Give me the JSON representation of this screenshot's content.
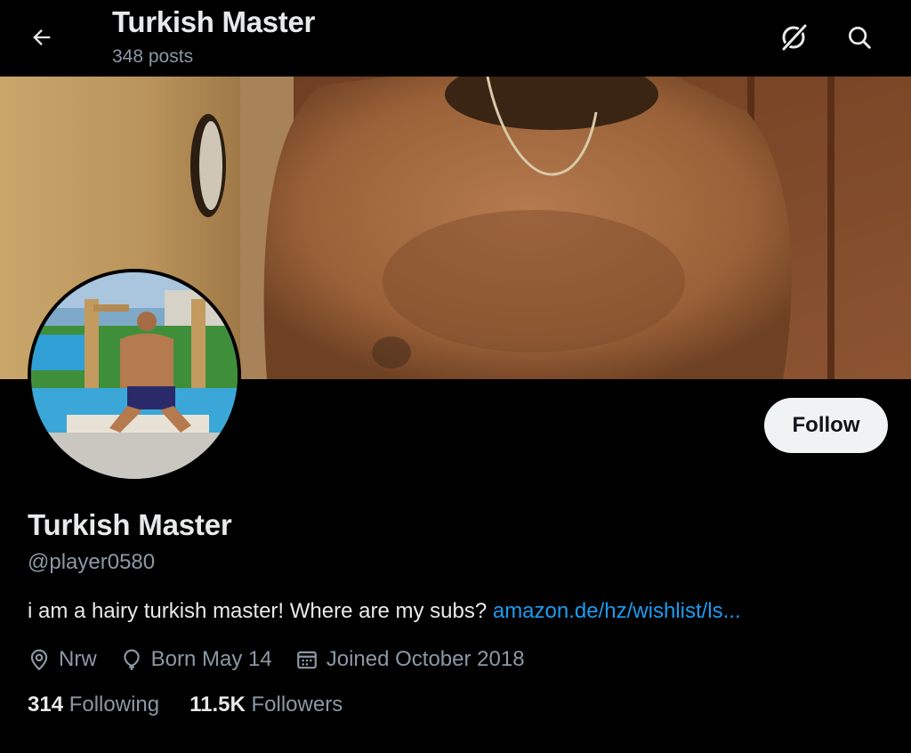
{
  "header": {
    "title": "Turkish Master",
    "posts": "348 posts",
    "back_icon": "arrow-left-icon",
    "grok_icon": "grok-icon",
    "search_icon": "search-icon"
  },
  "profile": {
    "name": "Turkish Master",
    "handle": "@player0580",
    "bio_text": "i am a hairy turkish master! Where are my subs? ",
    "bio_link": "amazon.de/hz/wishlist/ls...",
    "location": "Nrw",
    "birthday": "Born May 14",
    "joined": "Joined October 2018",
    "follow_label": "Follow"
  },
  "stats": {
    "following_count": "314",
    "following_label": "Following",
    "followers_count": "11.5K",
    "followers_label": "Followers"
  },
  "colors": {
    "background": "#000000",
    "text": "#e7e9ea",
    "secondary": "#8b98a5",
    "link": "#1d9bf0",
    "follow_button": "#eff3f4"
  }
}
